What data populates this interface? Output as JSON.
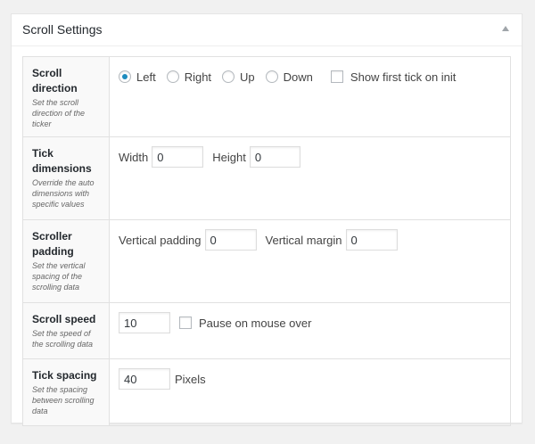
{
  "panel": {
    "title": "Scroll Settings"
  },
  "rows": {
    "direction": {
      "label": "Scroll direction",
      "description": "Set the scroll direction of the ticker",
      "options": {
        "left": "Left",
        "right": "Right",
        "up": "Up",
        "down": "Down"
      },
      "selected": "Left",
      "show_first_tick_label": "Show first tick on init",
      "show_first_tick_checked": false
    },
    "dimensions": {
      "label": "Tick dimensions",
      "description": "Override the auto dimensions with specific values",
      "width_label": "Width",
      "width_value": "0",
      "height_label": "Height",
      "height_value": "0"
    },
    "padding": {
      "label": "Scroller padding",
      "description": "Set the vertical spacing of the scrolling data",
      "vpadding_label": "Vertical padding",
      "vpadding_value": "0",
      "vmargin_label": "Vertical margin",
      "vmargin_value": "0"
    },
    "speed": {
      "label": "Scroll speed",
      "description": "Set the speed of the scrolling data",
      "value": "10",
      "pause_label": "Pause on mouse over",
      "pause_checked": false
    },
    "spacing": {
      "label": "Tick spacing",
      "description": "Set the spacing between scrolling data",
      "value": "40",
      "unit": "Pixels"
    }
  },
  "colors": {
    "accent": "#1e8cbe",
    "label_bg": "#f9f9f9",
    "border": "#e1e1e1"
  }
}
